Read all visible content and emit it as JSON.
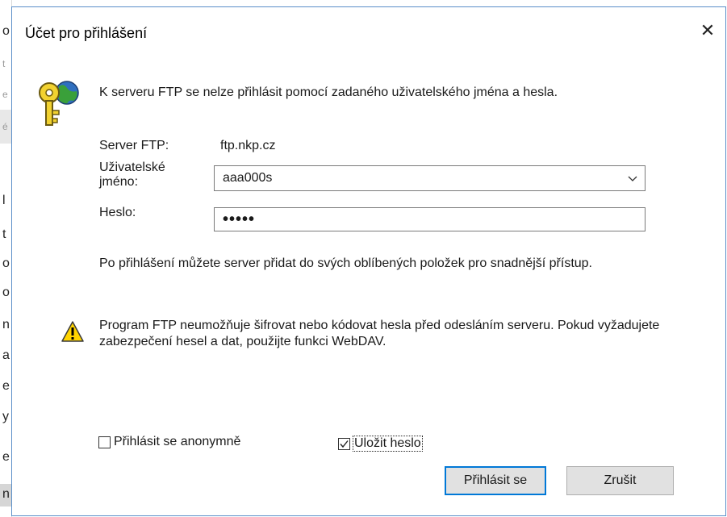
{
  "background": {
    "fragments": [
      "o",
      "t",
      "e",
      "é",
      "l",
      "t",
      "o",
      "o",
      "n",
      "a",
      "e",
      "y",
      "e",
      "n"
    ]
  },
  "dialog": {
    "title": "Účet pro přihlášení",
    "close_glyph": "✕",
    "error_message": "K serveru FTP se nelze přihlásit pomocí zadaného uživatelského jména a hesla.",
    "server_label": "Server FTP:",
    "server_value": "ftp.nkp.cz",
    "username_label_line1": "Uživatelské",
    "username_label_line2": "jméno:",
    "username_value": "aaa000s",
    "password_label": "Heslo:",
    "password_value": "•••••",
    "info_message": "Po přihlášení můžete server přidat do svých oblíbených položek pro snadnější přístup.",
    "warning_message": "Program FTP neumožňuje šifrovat nebo kódovat hesla před odesláním serveru. Pokud vyžadujete zabezpečení hesel a dat, použijte funkci WebDAV.",
    "anonymous_label": "Přihlásit se anonymně",
    "anonymous_checked": false,
    "save_password_label": "Uložit heslo",
    "save_password_checked": true,
    "login_button": "Přihlásit se",
    "cancel_button": "Zrušit"
  },
  "colors": {
    "accent": "#0078d7",
    "window_border": "#5b8fc9",
    "button_face": "#e1e1e1"
  },
  "icons": [
    "key-globe-icon",
    "warning-icon",
    "chevron-down-icon",
    "close-icon",
    "checkmark-icon"
  ]
}
